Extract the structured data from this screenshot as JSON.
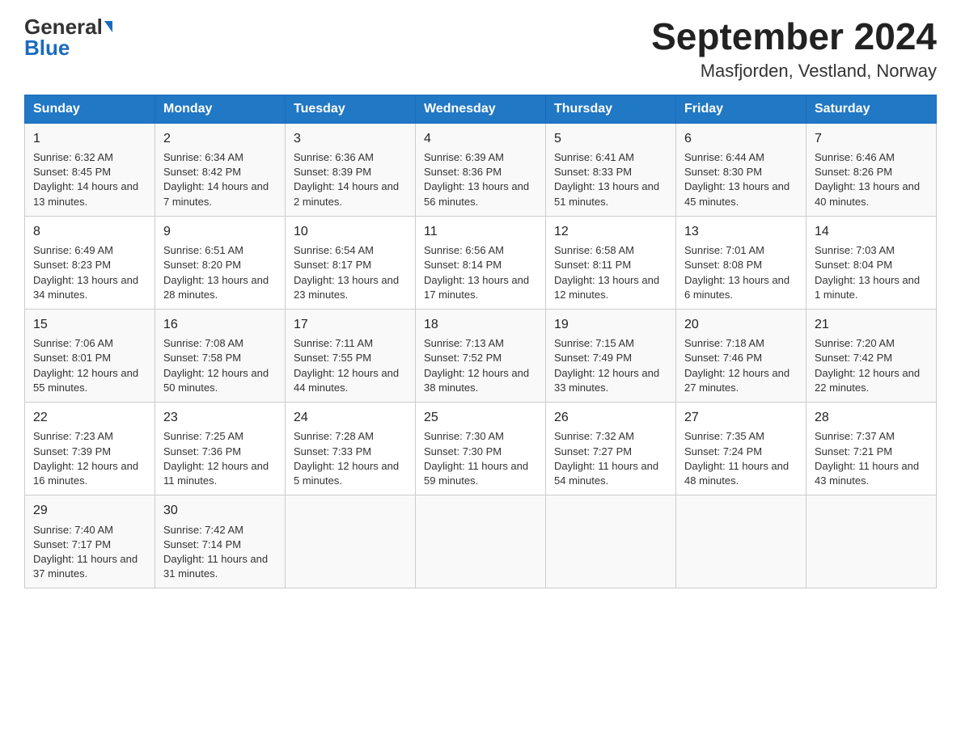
{
  "header": {
    "logo_general": "General",
    "logo_blue": "Blue",
    "month_year": "September 2024",
    "location": "Masfjorden, Vestland, Norway"
  },
  "weekdays": [
    "Sunday",
    "Monday",
    "Tuesday",
    "Wednesday",
    "Thursday",
    "Friday",
    "Saturday"
  ],
  "weeks": [
    [
      {
        "day": "1",
        "sunrise": "6:32 AM",
        "sunset": "8:45 PM",
        "daylight": "14 hours and 13 minutes."
      },
      {
        "day": "2",
        "sunrise": "6:34 AM",
        "sunset": "8:42 PM",
        "daylight": "14 hours and 7 minutes."
      },
      {
        "day": "3",
        "sunrise": "6:36 AM",
        "sunset": "8:39 PM",
        "daylight": "14 hours and 2 minutes."
      },
      {
        "day": "4",
        "sunrise": "6:39 AM",
        "sunset": "8:36 PM",
        "daylight": "13 hours and 56 minutes."
      },
      {
        "day": "5",
        "sunrise": "6:41 AM",
        "sunset": "8:33 PM",
        "daylight": "13 hours and 51 minutes."
      },
      {
        "day": "6",
        "sunrise": "6:44 AM",
        "sunset": "8:30 PM",
        "daylight": "13 hours and 45 minutes."
      },
      {
        "day": "7",
        "sunrise": "6:46 AM",
        "sunset": "8:26 PM",
        "daylight": "13 hours and 40 minutes."
      }
    ],
    [
      {
        "day": "8",
        "sunrise": "6:49 AM",
        "sunset": "8:23 PM",
        "daylight": "13 hours and 34 minutes."
      },
      {
        "day": "9",
        "sunrise": "6:51 AM",
        "sunset": "8:20 PM",
        "daylight": "13 hours and 28 minutes."
      },
      {
        "day": "10",
        "sunrise": "6:54 AM",
        "sunset": "8:17 PM",
        "daylight": "13 hours and 23 minutes."
      },
      {
        "day": "11",
        "sunrise": "6:56 AM",
        "sunset": "8:14 PM",
        "daylight": "13 hours and 17 minutes."
      },
      {
        "day": "12",
        "sunrise": "6:58 AM",
        "sunset": "8:11 PM",
        "daylight": "13 hours and 12 minutes."
      },
      {
        "day": "13",
        "sunrise": "7:01 AM",
        "sunset": "8:08 PM",
        "daylight": "13 hours and 6 minutes."
      },
      {
        "day": "14",
        "sunrise": "7:03 AM",
        "sunset": "8:04 PM",
        "daylight": "13 hours and 1 minute."
      }
    ],
    [
      {
        "day": "15",
        "sunrise": "7:06 AM",
        "sunset": "8:01 PM",
        "daylight": "12 hours and 55 minutes."
      },
      {
        "day": "16",
        "sunrise": "7:08 AM",
        "sunset": "7:58 PM",
        "daylight": "12 hours and 50 minutes."
      },
      {
        "day": "17",
        "sunrise": "7:11 AM",
        "sunset": "7:55 PM",
        "daylight": "12 hours and 44 minutes."
      },
      {
        "day": "18",
        "sunrise": "7:13 AM",
        "sunset": "7:52 PM",
        "daylight": "12 hours and 38 minutes."
      },
      {
        "day": "19",
        "sunrise": "7:15 AM",
        "sunset": "7:49 PM",
        "daylight": "12 hours and 33 minutes."
      },
      {
        "day": "20",
        "sunrise": "7:18 AM",
        "sunset": "7:46 PM",
        "daylight": "12 hours and 27 minutes."
      },
      {
        "day": "21",
        "sunrise": "7:20 AM",
        "sunset": "7:42 PM",
        "daylight": "12 hours and 22 minutes."
      }
    ],
    [
      {
        "day": "22",
        "sunrise": "7:23 AM",
        "sunset": "7:39 PM",
        "daylight": "12 hours and 16 minutes."
      },
      {
        "day": "23",
        "sunrise": "7:25 AM",
        "sunset": "7:36 PM",
        "daylight": "12 hours and 11 minutes."
      },
      {
        "day": "24",
        "sunrise": "7:28 AM",
        "sunset": "7:33 PM",
        "daylight": "12 hours and 5 minutes."
      },
      {
        "day": "25",
        "sunrise": "7:30 AM",
        "sunset": "7:30 PM",
        "daylight": "11 hours and 59 minutes."
      },
      {
        "day": "26",
        "sunrise": "7:32 AM",
        "sunset": "7:27 PM",
        "daylight": "11 hours and 54 minutes."
      },
      {
        "day": "27",
        "sunrise": "7:35 AM",
        "sunset": "7:24 PM",
        "daylight": "11 hours and 48 minutes."
      },
      {
        "day": "28",
        "sunrise": "7:37 AM",
        "sunset": "7:21 PM",
        "daylight": "11 hours and 43 minutes."
      }
    ],
    [
      {
        "day": "29",
        "sunrise": "7:40 AM",
        "sunset": "7:17 PM",
        "daylight": "11 hours and 37 minutes."
      },
      {
        "day": "30",
        "sunrise": "7:42 AM",
        "sunset": "7:14 PM",
        "daylight": "11 hours and 31 minutes."
      },
      null,
      null,
      null,
      null,
      null
    ]
  ]
}
